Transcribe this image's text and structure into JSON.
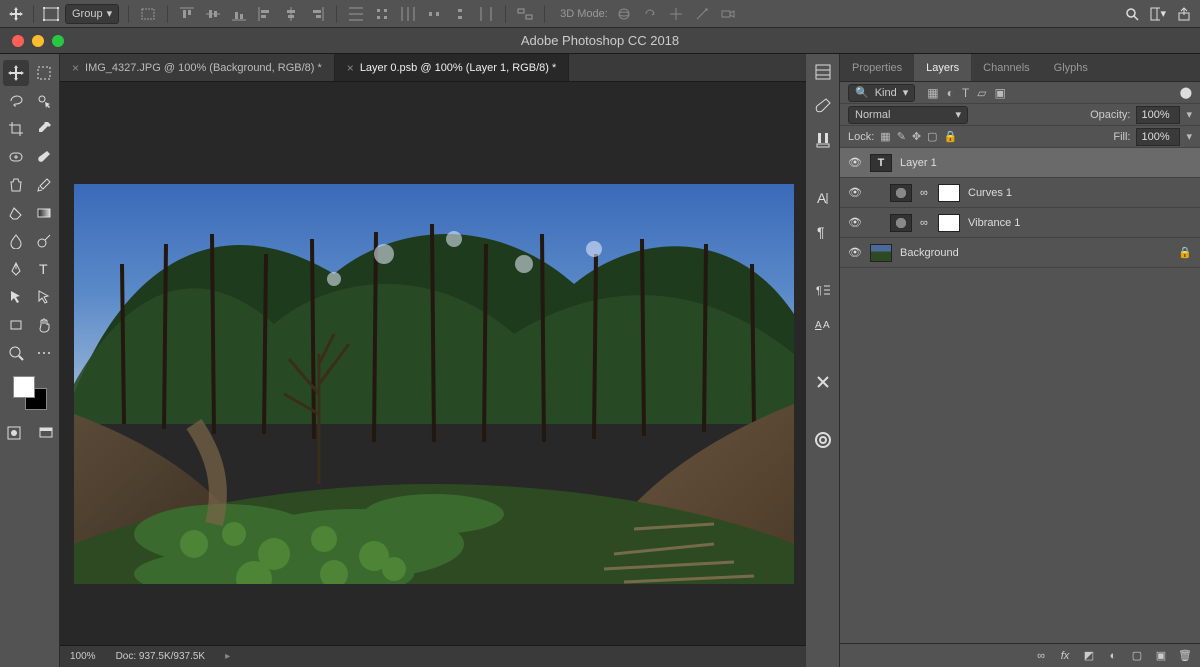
{
  "option_bar": {
    "group_label": "Group",
    "mode3d_label": "3D Mode:"
  },
  "window": {
    "title": "Adobe Photoshop CC 2018"
  },
  "doc_tabs": [
    {
      "label": "IMG_4327.JPG @ 100% (Background, RGB/8) *",
      "active": false
    },
    {
      "label": "Layer 0.psb @ 100% (Layer 1, RGB/8) *",
      "active": true
    }
  ],
  "status": {
    "zoom": "100%",
    "doc_info": "Doc: 937.5K/937.5K"
  },
  "panels": {
    "tabs": [
      "Properties",
      "Layers",
      "Channels",
      "Glyphs"
    ],
    "active_tab": "Layers",
    "kind_label": "Kind",
    "blend_mode": "Normal",
    "opacity_label": "Opacity:",
    "opacity_value": "100%",
    "lock_label": "Lock:",
    "fill_label": "Fill:",
    "fill_value": "100%",
    "layers": [
      {
        "name": "Layer 1",
        "type": "text",
        "selected": true
      },
      {
        "name": "Curves 1",
        "type": "adjustment",
        "selected": false
      },
      {
        "name": "Vibrance 1",
        "type": "adjustment",
        "selected": false
      },
      {
        "name": "Background",
        "type": "image",
        "selected": false,
        "locked": true
      }
    ]
  }
}
